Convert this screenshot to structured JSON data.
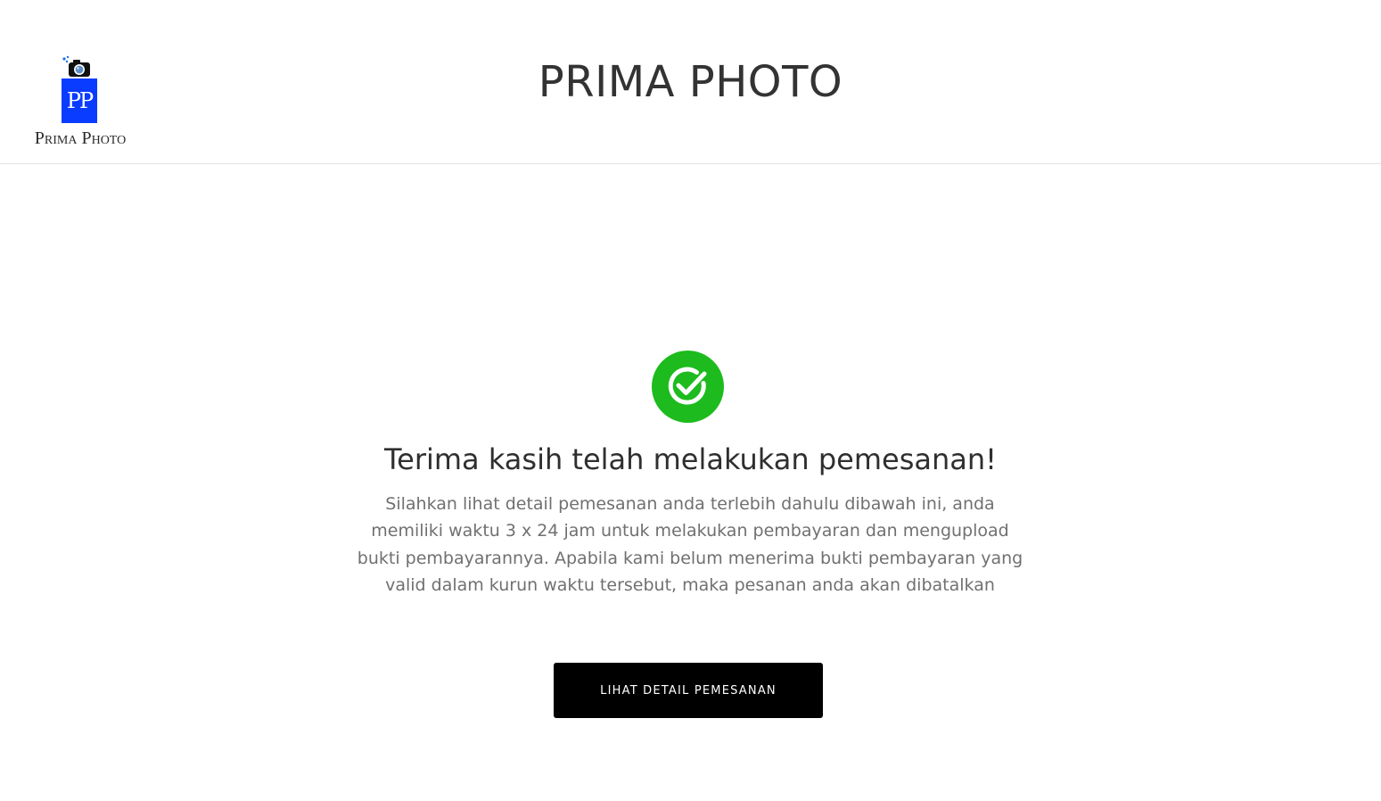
{
  "header": {
    "logo_text": "Prima Photo",
    "logo_monogram": "PP",
    "title": "PRIMA PHOTO"
  },
  "main": {
    "icon": "check-circle-icon",
    "heading": "Terima kasih telah melakukan pemesanan!",
    "message": "Silahkan lihat detail pemesanan anda terlebih dahulu dibawah ini, anda memiliki waktu 3 x 24 jam untuk melakukan pembayaran dan mengupload bukti pembayarannya. Apabila kami belum menerima bukti pembayaran yang valid dalam kurun waktu tersebut, maka pesanan anda akan dibatalkan",
    "button_label": "LIHAT DETAIL PEMESANAN"
  },
  "colors": {
    "success": "#1dbb1d",
    "logo_blue": "#0a3cff",
    "button_bg": "#000000"
  }
}
